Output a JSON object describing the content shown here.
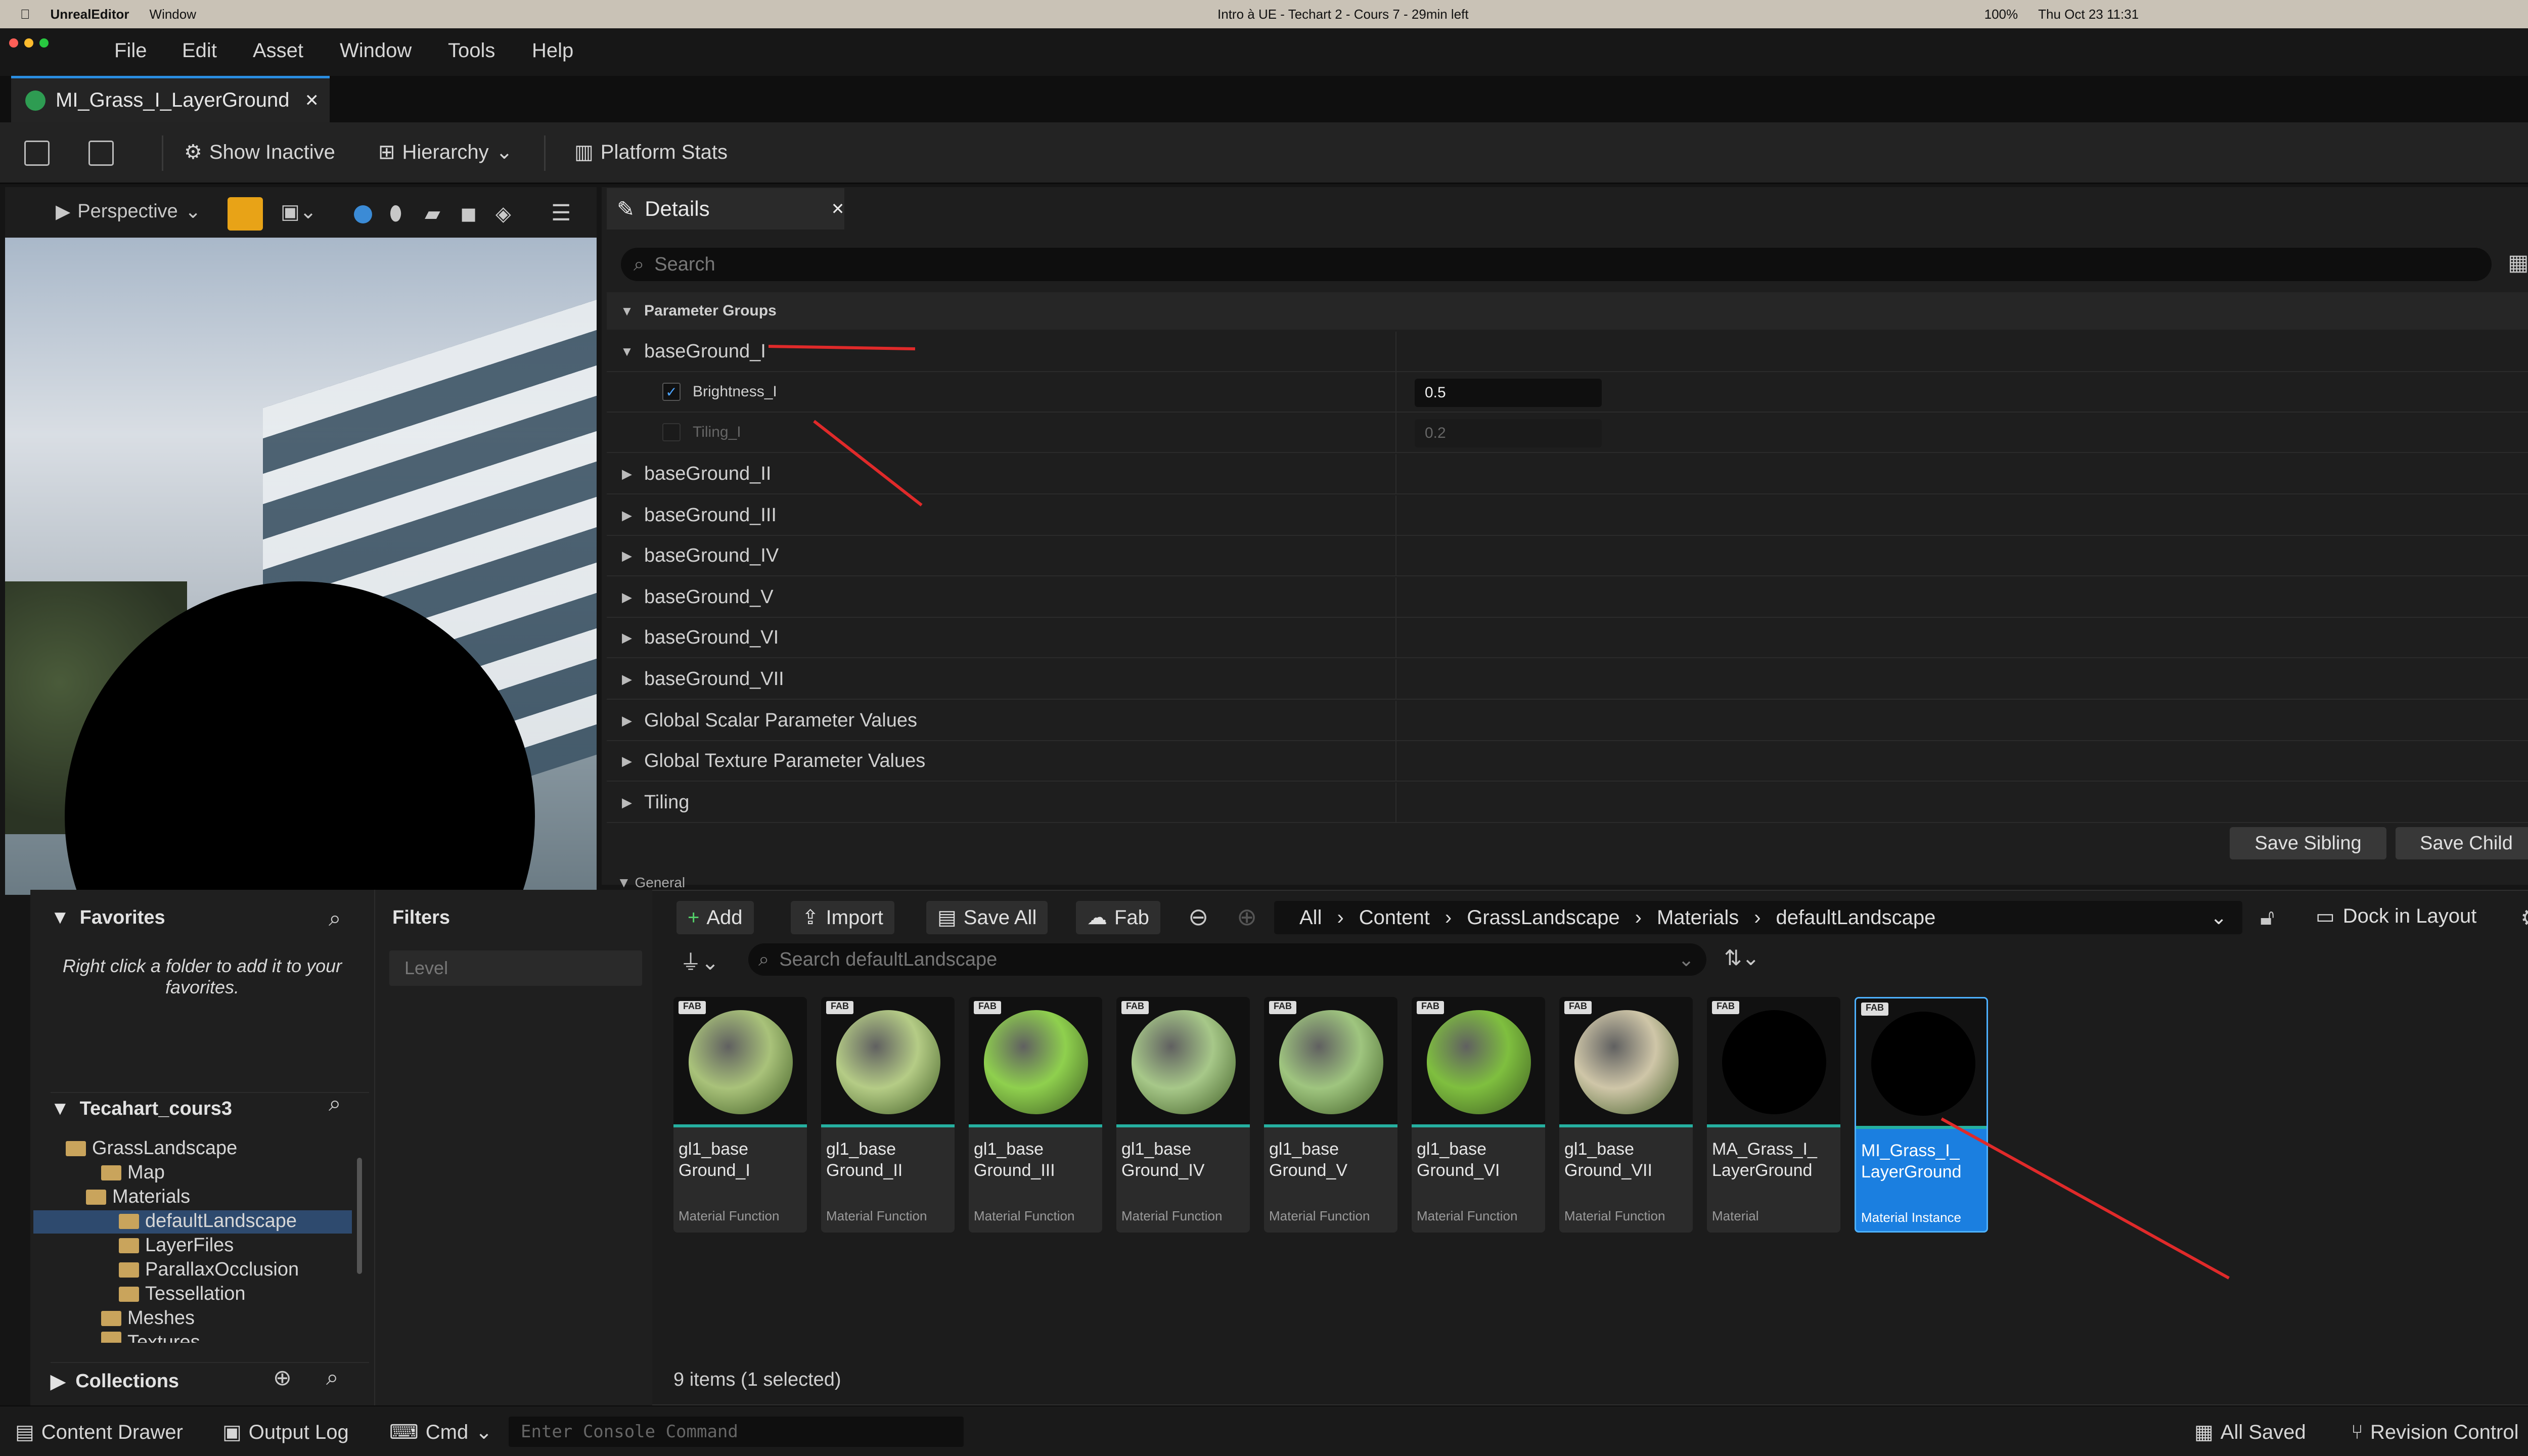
{
  "system_menubar": {
    "app": "UnrealEditor",
    "window": "Window",
    "status_center": "Intro à UE - Techart 2 - Cours 7 - 29min left",
    "battery": "100%",
    "datetime": "Thu Oct 23  11:31"
  },
  "menu": [
    "File",
    "Edit",
    "Asset",
    "Window",
    "Tools",
    "Help"
  ],
  "document_tab": {
    "title": "MI_Grass_I_LayerGround"
  },
  "toolbar": {
    "show_inactive": "Show Inactive",
    "hierarchy": "Hierarchy",
    "platform_stats": "Platform Stats"
  },
  "viewport": {
    "mode": "Perspective"
  },
  "details": {
    "tab_title": "Details",
    "search_placeholder": "Search",
    "section": "Parameter Groups",
    "groups": [
      {
        "label": "baseGround_I",
        "expanded": true
      },
      {
        "label": "baseGround_II"
      },
      {
        "label": "baseGround_III"
      },
      {
        "label": "baseGround_IV"
      },
      {
        "label": "baseGround_V"
      },
      {
        "label": "baseGround_VI"
      },
      {
        "label": "baseGround_VII"
      },
      {
        "label": "Global Scalar Parameter Values"
      },
      {
        "label": "Global Texture Parameter Values"
      },
      {
        "label": "Tiling"
      }
    ],
    "params": [
      {
        "name": "Brightness_I",
        "value": "0.5",
        "checked": true
      },
      {
        "name": "Tiling_I",
        "value": "0.2",
        "checked": false
      }
    ],
    "save_sibling": "Save Sibling",
    "save_child": "Save Child",
    "general": "General"
  },
  "content_browser": {
    "favorites_title": "Favorites",
    "favorites_hint": "Right click a folder to add it to your favorites.",
    "project_title": "Tecahart_cours3",
    "tree": [
      "GrassLandscape",
      "Map",
      "Materials",
      "defaultLandscape",
      "LayerFiles",
      "ParallaxOcclusion",
      "Tessellation",
      "Meshes",
      "Textures"
    ],
    "collections": "Collections",
    "filters_title": "Filters",
    "filter_level": "Level",
    "add": "Add",
    "import": "Import",
    "save_all": "Save All",
    "fab": "Fab",
    "path": [
      "All",
      "Content",
      "GrassLandscape",
      "Materials",
      "defaultLandscape"
    ],
    "dock": "Dock in Layout",
    "search_placeholder": "Search defaultLandscape",
    "assets": [
      {
        "name": "gl1_base Ground_I",
        "type": "Material Function",
        "color": "#a9c27a"
      },
      {
        "name": "gl1_base Ground_II",
        "type": "Material Function",
        "color": "#b5cc86"
      },
      {
        "name": "gl1_base Ground_III",
        "type": "Material Function",
        "color": "#8fd04e"
      },
      {
        "name": "gl1_base Ground_IV",
        "type": "Material Function",
        "color": "#a7c889"
      },
      {
        "name": "gl1_base Ground_V",
        "type": "Material Function",
        "color": "#9fc57f"
      },
      {
        "name": "gl1_base Ground_VI",
        "type": "Material Function",
        "color": "#7fbf3f"
      },
      {
        "name": "gl1_base Ground_VII",
        "type": "Material Function",
        "color": "#cfc6a8"
      },
      {
        "name": "MA_Grass_I_ LayerGround",
        "type": "Material",
        "color": "#000000"
      },
      {
        "name": "MI_Grass_I_ LayerGround",
        "type": "Material Instance",
        "color": "#000000",
        "selected": true
      }
    ],
    "item_count": "9 items (1 selected)"
  },
  "statusbar": {
    "content_drawer": "Content Drawer",
    "output_log": "Output Log",
    "cmd": "Cmd",
    "console_placeholder": "Enter Console Command",
    "all_saved": "All Saved",
    "revision": "Revision Control"
  }
}
